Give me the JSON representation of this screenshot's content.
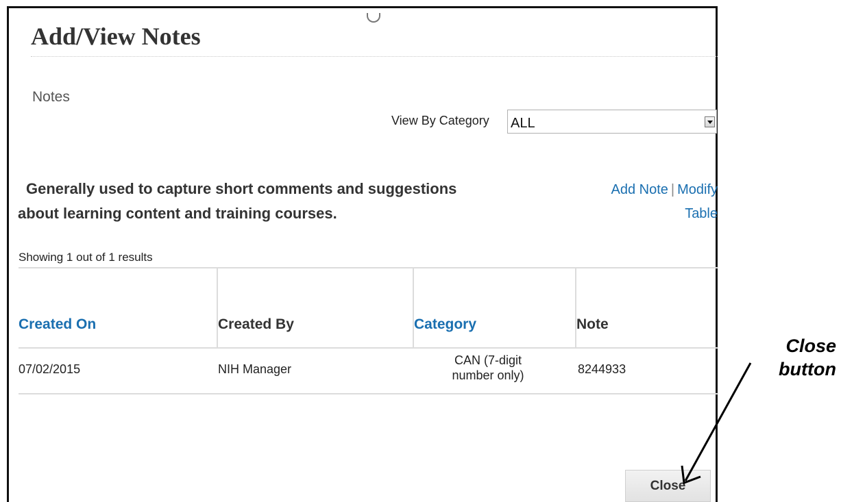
{
  "dialog": {
    "title": "Add/View Notes",
    "section_label": "Notes",
    "filter": {
      "label": "View By Category",
      "selected": "ALL"
    },
    "description_line1": "Generally used to capture short comments and suggestions",
    "description_line2": "about learning content and training courses.",
    "actions": {
      "add_note": "Add Note",
      "separator": "|",
      "modify_table": "Modify Table"
    },
    "results_count": "Showing 1 out of 1 results",
    "table": {
      "columns": [
        "Created On",
        "Created By",
        "Category",
        "Note"
      ],
      "rows": [
        {
          "created_on": "07/02/2015",
          "created_by": "NIH Manager",
          "category": "CAN (7-digit number only)",
          "note": "8244933"
        }
      ]
    },
    "close_label": "Close"
  },
  "annotation": {
    "line1": "Close",
    "line2": "button"
  },
  "colors": {
    "link": "#1a6fb0",
    "text": "#333333",
    "border": "#dcdcdc"
  }
}
